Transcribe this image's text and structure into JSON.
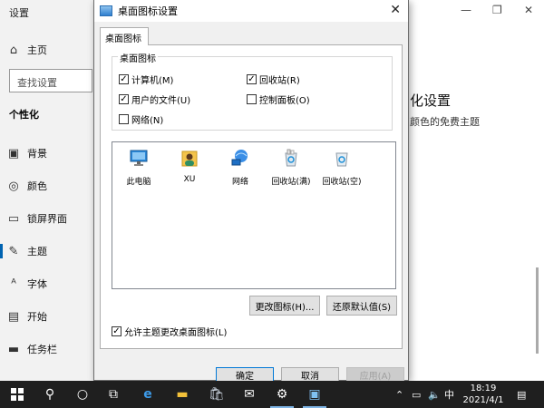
{
  "settings": {
    "title": "设置",
    "home_label": "主页",
    "search_placeholder": "查找设置",
    "section_heading": "个性化",
    "nav": [
      {
        "label": "背景",
        "icon": "picture-icon"
      },
      {
        "label": "颜色",
        "icon": "palette-icon"
      },
      {
        "label": "锁屏界面",
        "icon": "lock-screen-icon"
      },
      {
        "label": "主题",
        "icon": "brush-icon"
      },
      {
        "label": "字体",
        "icon": "font-icon"
      },
      {
        "label": "开始",
        "icon": "start-icon"
      },
      {
        "label": "任务栏",
        "icon": "taskbar-icon"
      }
    ],
    "active_index": 3,
    "right_heading": "化设置",
    "right_link": "颜色的免费主题"
  },
  "dialog": {
    "title": "桌面图标设置",
    "tab": "桌面图标",
    "group_label": "桌面图标",
    "checkboxes": [
      {
        "label": "计算机(M)",
        "checked": true
      },
      {
        "label": "回收站(R)",
        "checked": true
      },
      {
        "label": "用户的文件(U)",
        "checked": true
      },
      {
        "label": "控制面板(O)",
        "checked": false
      },
      {
        "label": "网络(N)",
        "checked": false
      }
    ],
    "icons": [
      {
        "label": "此电脑",
        "icon": "this-pc-icon"
      },
      {
        "label": "XU",
        "icon": "user-folder-icon"
      },
      {
        "label": "网络",
        "icon": "network-icon"
      },
      {
        "label": "回收站(满)",
        "icon": "recycle-bin-full-icon"
      },
      {
        "label": "回收站(空)",
        "icon": "recycle-bin-empty-icon"
      }
    ],
    "change_icon_button": "更改图标(H)...",
    "restore_default_button": "还原默认值(S)",
    "allow_themes_label": "允许主题更改桌面图标(L)",
    "allow_themes_checked": true,
    "ok_button": "确定",
    "cancel_button": "取消",
    "apply_button": "应用(A)"
  },
  "taskbar": {
    "input_method": "中",
    "time": "18:19",
    "date": "2021/4/1"
  },
  "colors": {
    "accent": "#0078d7",
    "taskbar": "#1f1f1f",
    "sidebar": "#f2f2f2"
  }
}
